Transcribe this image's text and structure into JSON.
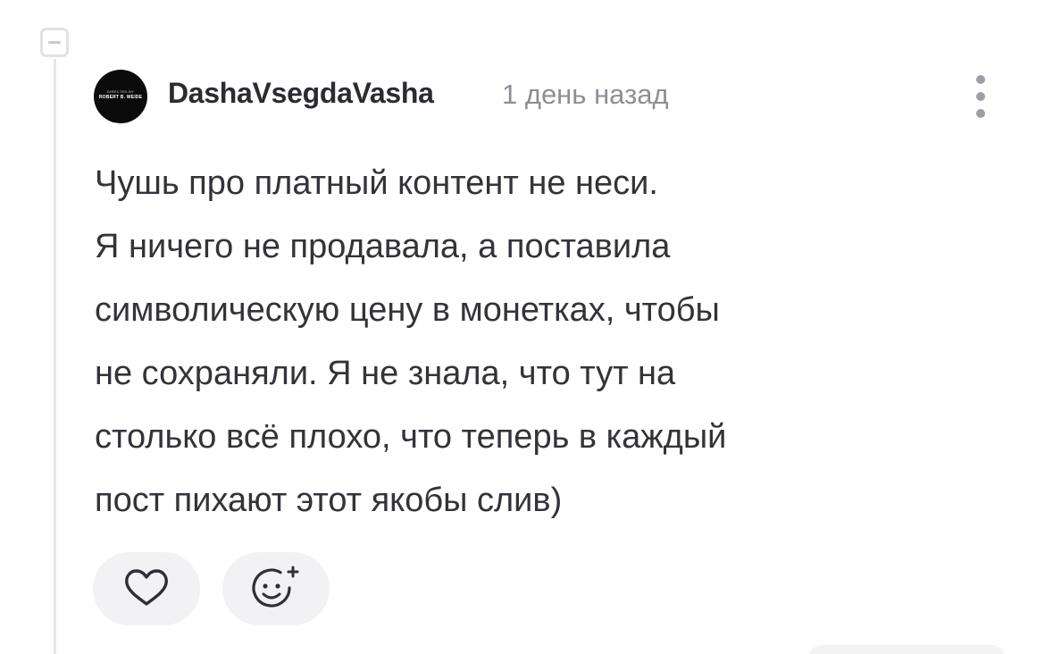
{
  "comment": {
    "author": "DashaVsegdaVasha",
    "time": "1 день назад",
    "avatar": {
      "line1": "DIRECTED BY",
      "line2": "ROBERT B. WEIDE"
    },
    "lines": [
      "Чушь про платный контент не неси.",
      "Я ничего не продавала, а поставила",
      "символическую цену в монетках, чтобы",
      "не сохраняли. Я не знала, что тут на",
      "столько всё плохо, что теперь в каждый",
      "пост пихают этот якобы слив)"
    ]
  },
  "icons": {
    "collapse": "minus-square-icon",
    "more": "vertical-dots-icon",
    "like": "heart-outline-icon",
    "react": "smiley-plus-icon"
  },
  "colors": {
    "text": "#33333b",
    "muted": "#8e8e96",
    "button_bg": "#f2f2f5",
    "thread_line": "#e6e6ea"
  }
}
